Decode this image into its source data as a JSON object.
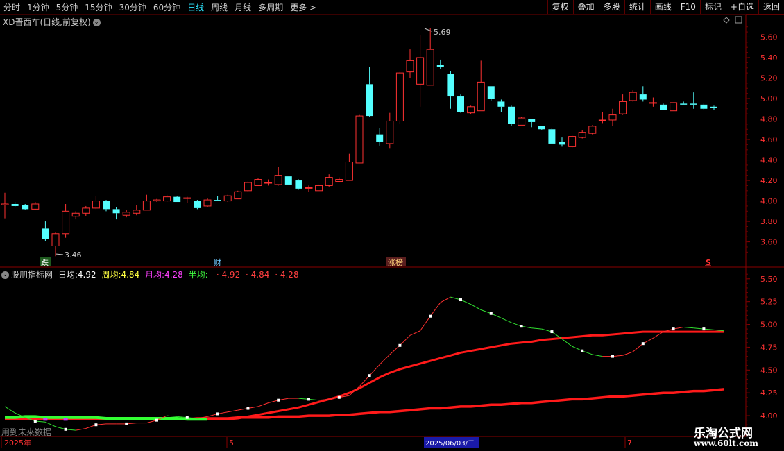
{
  "toolbar": {
    "tabs": [
      "分时",
      "1分钟",
      "5分钟",
      "15分钟",
      "30分钟",
      "60分钟",
      "日线",
      "周线",
      "月线",
      "多周期",
      "更多"
    ],
    "active": "日线",
    "right": [
      "复权",
      "叠加",
      "多股",
      "统计",
      "画线",
      "F10",
      "标记",
      "+自选",
      "返回"
    ]
  },
  "main_title": "XD晋西车(日线,前复权)",
  "price_axis": [
    "5.60",
    "5.40",
    "5.20",
    "5.00",
    "4.80",
    "4.60",
    "4.40",
    "4.20",
    "4.00",
    "3.80",
    "3.60"
  ],
  "high_label": "5.69",
  "low_label": "3.46",
  "markers": {
    "die": "跌",
    "cai": "财",
    "zhangbang": "涨榜",
    "s": "S"
  },
  "indicator": {
    "name": "股朋指标网",
    "ri_label": "日均:",
    "ri_val": "4.92",
    "zhou_label": "周均:",
    "zhou_val": "4.84",
    "yue_label": "月均:",
    "yue_val": "4.28",
    "ban_label": "半均:",
    "ban_val": "-",
    "extra1": "4.92",
    "extra2": "4.84",
    "extra3": "4.28"
  },
  "ind_axis": [
    "5.50",
    "5.25",
    "5.00",
    "4.75",
    "4.50",
    "4.25",
    "4.00"
  ],
  "future_note": "用到未来数据",
  "time_axis": {
    "year": "2025年",
    "m5": "5",
    "date": "2025/06/03/二",
    "m7": "7"
  },
  "watermark": {
    "line1": "乐淘公式网",
    "line2": "www.60lt.com"
  },
  "colors": {
    "up": "#ff3232",
    "down": "#54ffff",
    "bg": "#000000",
    "grid": "#7a0000"
  },
  "chart_data": {
    "type": "candlestick",
    "candles": [
      [
        3.96,
        3.97,
        4.08,
        3.83
      ],
      [
        3.97,
        3.95,
        3.99,
        3.94
      ],
      [
        3.96,
        3.92,
        3.97,
        3.91
      ],
      [
        3.92,
        3.97,
        3.99,
        3.91
      ],
      [
        3.73,
        3.63,
        3.8,
        3.61
      ],
      [
        3.56,
        3.68,
        3.69,
        3.46
      ],
      [
        3.68,
        3.9,
        3.97,
        3.64
      ],
      [
        3.85,
        3.88,
        3.9,
        3.82
      ],
      [
        3.88,
        3.93,
        3.95,
        3.85
      ],
      [
        3.93,
        4.0,
        4.05,
        3.92
      ],
      [
        4.0,
        3.92,
        4.01,
        3.9
      ],
      [
        3.92,
        3.88,
        3.94,
        3.82
      ],
      [
        3.86,
        3.89,
        3.91,
        3.84
      ],
      [
        3.88,
        3.91,
        3.96,
        3.86
      ],
      [
        3.91,
        4.0,
        4.06,
        3.91
      ],
      [
        4.0,
        4.01,
        4.02,
        3.99
      ],
      [
        4.0,
        4.04,
        4.06,
        3.99
      ],
      [
        4.04,
        3.99,
        4.05,
        3.99
      ],
      [
        4.03,
        4.03,
        4.04,
        3.98
      ],
      [
        4.0,
        3.93,
        4.01,
        3.92
      ],
      [
        3.95,
        4.01,
        4.03,
        3.94
      ],
      [
        4.01,
        4.0,
        4.05,
        4.0
      ],
      [
        4.0,
        4.05,
        4.06,
        3.99
      ],
      [
        4.02,
        4.09,
        4.1,
        4.02
      ],
      [
        4.1,
        4.18,
        4.19,
        4.09
      ],
      [
        4.15,
        4.21,
        4.22,
        4.15
      ],
      [
        4.18,
        4.18,
        4.21,
        4.15
      ],
      [
        4.16,
        4.25,
        4.33,
        4.15
      ],
      [
        4.24,
        4.16,
        4.24,
        4.16
      ],
      [
        4.2,
        4.12,
        4.21,
        4.11
      ],
      [
        4.13,
        4.13,
        4.15,
        4.09
      ],
      [
        4.1,
        4.15,
        4.16,
        4.1
      ],
      [
        4.15,
        4.23,
        4.26,
        4.14
      ],
      [
        4.19,
        4.21,
        4.23,
        4.19
      ],
      [
        4.2,
        4.38,
        4.46,
        4.2
      ],
      [
        4.37,
        4.83,
        4.84,
        4.37
      ],
      [
        5.14,
        4.83,
        5.31,
        4.82
      ],
      [
        4.65,
        4.58,
        4.71,
        4.54
      ],
      [
        4.56,
        4.78,
        4.86,
        4.51
      ],
      [
        4.78,
        5.25,
        5.26,
        4.75
      ],
      [
        5.26,
        5.37,
        5.48,
        5.2
      ],
      [
        5.14,
        5.4,
        5.62,
        4.92
      ],
      [
        5.13,
        5.48,
        5.69,
        5.13
      ],
      [
        5.33,
        5.31,
        5.38,
        5.29
      ],
      [
        5.24,
        5.02,
        5.27,
        4.9
      ],
      [
        5.02,
        4.87,
        5.04,
        4.86
      ],
      [
        4.86,
        4.92,
        4.93,
        4.85
      ],
      [
        4.88,
        5.16,
        5.37,
        4.88
      ],
      [
        5.12,
        5.0,
        5.12,
        4.98
      ],
      [
        4.97,
        4.92,
        4.99,
        4.87
      ],
      [
        4.92,
        4.75,
        4.93,
        4.73
      ],
      [
        4.74,
        4.81,
        4.82,
        4.74
      ],
      [
        4.8,
        4.77,
        4.8,
        4.72
      ],
      [
        4.73,
        4.7,
        4.73,
        4.69
      ],
      [
        4.7,
        4.56,
        4.71,
        4.56
      ],
      [
        4.58,
        4.55,
        4.62,
        4.53
      ],
      [
        4.53,
        4.63,
        4.64,
        4.52
      ],
      [
        4.62,
        4.67,
        4.69,
        4.61
      ],
      [
        4.66,
        4.73,
        4.74,
        4.65
      ],
      [
        4.79,
        4.79,
        4.87,
        4.76
      ],
      [
        4.79,
        4.84,
        4.9,
        4.73
      ],
      [
        4.85,
        4.97,
        5.04,
        4.84
      ],
      [
        4.98,
        5.06,
        5.08,
        4.97
      ],
      [
        5.04,
        4.99,
        5.12,
        4.97
      ],
      [
        4.96,
        4.96,
        5.01,
        4.92
      ],
      [
        4.94,
        4.89,
        4.95,
        4.89
      ],
      [
        4.88,
        4.96,
        4.96,
        4.88
      ],
      [
        4.95,
        4.94,
        4.97,
        4.94
      ],
      [
        4.95,
        4.94,
        5.06,
        4.9
      ],
      [
        4.94,
        4.9,
        4.95,
        4.89
      ],
      [
        4.92,
        4.91,
        4.93,
        4.89
      ]
    ],
    "price_range": [
      3.36,
      5.82
    ],
    "indicator_range": [
      3.78,
      5.62
    ],
    "daily_avg": [
      4.1,
      4.03,
      3.98,
      3.94,
      3.93,
      3.88,
      3.85,
      3.84,
      3.86,
      3.9,
      3.91,
      3.91,
      3.91,
      3.92,
      3.92,
      3.95,
      4.0,
      3.99,
      3.98,
      3.97,
      3.99,
      4.02,
      4.04,
      4.06,
      4.08,
      4.1,
      4.14,
      4.17,
      4.19,
      4.19,
      4.18,
      4.17,
      4.18,
      4.2,
      4.22,
      4.32,
      4.44,
      4.56,
      4.67,
      4.77,
      4.88,
      4.93,
      5.09,
      5.24,
      5.3,
      5.27,
      5.22,
      5.16,
      5.12,
      5.07,
      5.02,
      4.98,
      4.96,
      4.95,
      4.92,
      4.84,
      4.76,
      4.71,
      4.67,
      4.65,
      4.65,
      4.66,
      4.7,
      4.79,
      4.85,
      4.92,
      4.95,
      4.97,
      4.96,
      4.95,
      4.94,
      4.93
    ],
    "week_avg": [
      3.96,
      3.96,
      3.96,
      3.96,
      3.96,
      3.96,
      3.96,
      3.96,
      3.96,
      3.96,
      3.96,
      3.96,
      3.96,
      3.96,
      3.96,
      3.96,
      3.96,
      3.96,
      3.96,
      3.96,
      3.96,
      3.96,
      3.96,
      3.97,
      3.99,
      4.01,
      4.03,
      4.05,
      4.07,
      4.09,
      4.12,
      4.15,
      4.18,
      4.21,
      4.25,
      4.3,
      4.36,
      4.42,
      4.47,
      4.51,
      4.54,
      4.57,
      4.6,
      4.63,
      4.66,
      4.69,
      4.71,
      4.73,
      4.75,
      4.77,
      4.79,
      4.8,
      4.81,
      4.83,
      4.84,
      4.85,
      4.86,
      4.87,
      4.88,
      4.88,
      4.89,
      4.9,
      4.91,
      4.92,
      4.92,
      4.92,
      4.92,
      4.92,
      4.92,
      4.92,
      4.92,
      4.92
    ],
    "month_avg": [
      3.96,
      3.96,
      3.96,
      3.96,
      3.96,
      3.96,
      3.96,
      3.96,
      3.96,
      3.96,
      3.96,
      3.96,
      3.96,
      3.96,
      3.96,
      3.96,
      3.96,
      3.96,
      3.96,
      3.97,
      3.97,
      3.97,
      3.97,
      3.98,
      3.98,
      3.98,
      3.98,
      3.99,
      3.99,
      3.99,
      4.0,
      4.0,
      4.0,
      4.01,
      4.01,
      4.02,
      4.03,
      4.04,
      4.04,
      4.05,
      4.06,
      4.07,
      4.08,
      4.08,
      4.09,
      4.1,
      4.1,
      4.11,
      4.12,
      4.12,
      4.13,
      4.14,
      4.14,
      4.15,
      4.16,
      4.17,
      4.18,
      4.18,
      4.19,
      4.2,
      4.21,
      4.21,
      4.22,
      4.23,
      4.24,
      4.25,
      4.25,
      4.26,
      4.27,
      4.27,
      4.28,
      4.29
    ],
    "half_avg_green": [
      3.98,
      3.98,
      3.99,
      3.99,
      3.98,
      3.98,
      3.98,
      3.98,
      3.98,
      3.98,
      3.97,
      3.97,
      3.97,
      3.97,
      3.97,
      3.97,
      3.97,
      3.97,
      3.96,
      3.96,
      3.96
    ]
  }
}
